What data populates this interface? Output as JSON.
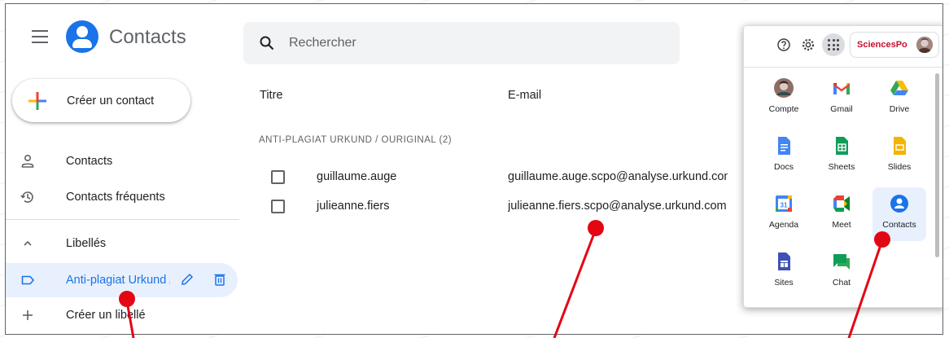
{
  "header": {
    "app_title": "Contacts",
    "search_placeholder": "Rechercher"
  },
  "sidebar": {
    "create_label": "Créer un contact",
    "items": [
      {
        "label": "Contacts",
        "icon": "person-icon"
      },
      {
        "label": "Contacts fréquents",
        "icon": "history-icon"
      }
    ],
    "labels_section": "Libellés",
    "active_label": "Anti-plagiat Urkund / Ouriginal",
    "create_label_item": "Créer un libellé"
  },
  "table": {
    "col_title": "Titre",
    "col_email": "E-mail",
    "group_header": "ANTI-PLAGIAT URKUND / OURIGINAL (2)",
    "rows": [
      {
        "name": "guillaume.auge",
        "email": "guillaume.auge.scpo@analyse.urkund.com"
      },
      {
        "name": "julieanne.fiers",
        "email": "julieanne.fiers.scpo@analyse.urkund.com"
      }
    ]
  },
  "apps_panel": {
    "account_name": "SciencesPo",
    "apps": [
      {
        "label": "Compte",
        "icon": "account-icon"
      },
      {
        "label": "Gmail",
        "icon": "gmail-icon"
      },
      {
        "label": "Drive",
        "icon": "drive-icon"
      },
      {
        "label": "Docs",
        "icon": "docs-icon"
      },
      {
        "label": "Sheets",
        "icon": "sheets-icon"
      },
      {
        "label": "Slides",
        "icon": "slides-icon"
      },
      {
        "label": "Agenda",
        "icon": "calendar-icon",
        "icon_text": "31"
      },
      {
        "label": "Meet",
        "icon": "meet-icon"
      },
      {
        "label": "Contacts",
        "icon": "contacts-icon"
      },
      {
        "label": "Sites",
        "icon": "sites-icon"
      },
      {
        "label": "Chat",
        "icon": "chat-icon"
      }
    ]
  },
  "colors": {
    "accent": "#1a73e8",
    "active_bg": "#e8f0fe",
    "annotation": "#e30613",
    "brand_red": "#c8102e"
  }
}
